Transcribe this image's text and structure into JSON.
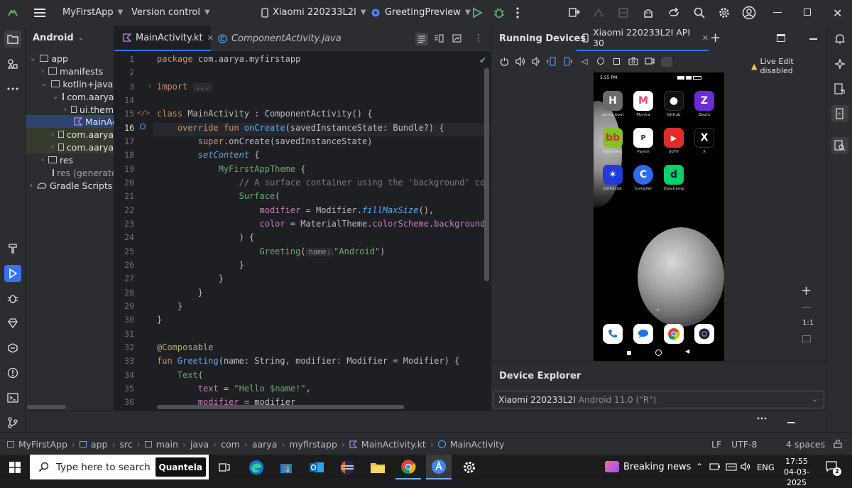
{
  "titlebar": {
    "project_name": "MyFirstApp",
    "vcs_label": "Version control",
    "device_name": "Xiaomi 220233L2I",
    "run_config": "GreetingPreview"
  },
  "project_panel": {
    "view_label": "Android",
    "tree": [
      {
        "label": "app"
      },
      {
        "label": "manifests"
      },
      {
        "label": "kotlin+java"
      },
      {
        "label": "com.aarya"
      },
      {
        "label": "ui.them"
      },
      {
        "label": "MainAc"
      },
      {
        "label": "com.aarya"
      },
      {
        "label": "com.aarya"
      },
      {
        "label": "res"
      },
      {
        "label": "res (generate"
      },
      {
        "label": "Gradle Scripts"
      }
    ]
  },
  "editor": {
    "tabs": [
      {
        "label": "MainActivity.kt"
      },
      {
        "label": "ComponentActivity.java"
      }
    ],
    "line_numbers": [
      "1",
      "2",
      "3",
      "14",
      "15",
      "16",
      "17",
      "18",
      "19",
      "20",
      "21",
      "22",
      "23",
      "24",
      "25",
      "26",
      "27",
      "28",
      "29",
      "30",
      "31",
      "32",
      "33",
      "34",
      "35",
      "36"
    ],
    "code": {
      "l1_kw": "package",
      "l1_rest": " com.aarya.myfirstapp",
      "l3_kw": "import",
      "l3_fold": "...",
      "l15_a": "class",
      "l15_b": " MainActivity : ComponentActivity() {",
      "l16_indent": "    ",
      "l16_kw": "override fun",
      "l16_fn": " onCreate",
      "l16_rest": "(savedInstanceState: Bundle?) {",
      "l17_indent": "        ",
      "l17_kw": "super",
      "l17_rest": ".onCreate(savedInstanceState)",
      "l18_indent": "        ",
      "l18_fn": "setContent",
      "l18_rest": " {",
      "l19_indent": "            ",
      "l19_comp": "MyFirstAppTheme",
      "l19_rest": " {",
      "l20_indent": "                ",
      "l20_cm": "// A surface container using the 'background' color",
      "l21_indent": "                ",
      "l21_comp": "Surface",
      "l21_rest": "(",
      "l22_indent": "                    ",
      "l22_prop": "modifier",
      "l22_mid": " = Modifier.",
      "l22_fn": "fillMaxSize",
      "l22_rest": "(),",
      "l23_indent": "                    ",
      "l23_prop": "color",
      "l23_mid": " = MaterialTheme.",
      "l23_p2": "colorScheme",
      "l23_dot": ".",
      "l23_p3": "background",
      "l24_indent": "                ",
      "l24_rest": ") {",
      "l25_indent": "                    ",
      "l25_comp": "Greeting",
      "l25_paren": "(",
      "l25_hint": "name:",
      "l25_str": "\"Android\"",
      "l25_close": ")",
      "l26_indent": "                ",
      "l26_rest": "}",
      "l27_indent": "            ",
      "l27_rest": "}",
      "l28_indent": "        ",
      "l28_rest": "}",
      "l29_indent": "    ",
      "l29_rest": "}",
      "l30": "}",
      "l32_ann": "@Composable",
      "l33_kw": "fun",
      "l33_fn": " Greeting",
      "l33_rest": "(name: String, modifier: Modifier = Modifier) {",
      "l34_indent": "    ",
      "l34_comp": "Text",
      "l34_rest": "(",
      "l35_indent": "        ",
      "l35_prop": "text",
      "l35_mid": " = ",
      "l35_str": "\"Hello $name!\"",
      "l35_rest": ",",
      "l36_indent": "        ",
      "l36_prop": "modifier",
      "l36_rest": " = modifier"
    }
  },
  "running_devices": {
    "title": "Running Devices",
    "device_tab": "Xiaomi 220233L2I API 30",
    "live_edit": "Live Edit disabled",
    "zoom_label": "1:1",
    "phone": {
      "status_time": "5:55 PM",
      "apps": [
        {
          "label": "spring boot",
          "glyph": "H",
          "color": "#6b6b6b"
        },
        {
          "label": "Myntra",
          "glyph": "M",
          "color": "#e8477b"
        },
        {
          "label": "GitHub",
          "glyph": "●",
          "color": "#111111"
        },
        {
          "label": "Zepto",
          "glyph": "Z",
          "color": "#6b2bd9"
        },
        {
          "label": "bigbasket",
          "glyph": "bb",
          "color": "#84c225"
        },
        {
          "label": "Paytm",
          "glyph": "P",
          "color": "#ffffff"
        },
        {
          "label": "JioTV",
          "glyph": "▶",
          "color": "#e22b2b"
        },
        {
          "label": "X",
          "glyph": "X",
          "color": "#000000"
        },
        {
          "label": "JioHotstar",
          "glyph": "✶",
          "color": "#1f3bdb"
        },
        {
          "label": "Compiler",
          "glyph": "C",
          "color": "#2d6cf2"
        },
        {
          "label": "DataCamp",
          "glyph": "d",
          "color": "#05d26a"
        }
      ]
    }
  },
  "device_explorer": {
    "title": "Device Explorer",
    "device": "Xiaomi 220233L2I",
    "android": "Android 11.0 (\"R\")"
  },
  "statusbar": {
    "breadcrumbs": [
      "MyFirstApp",
      "app",
      "src",
      "main",
      "java",
      "com",
      "aarya",
      "myfirstapp",
      "MainActivity.kt",
      "MainActivity"
    ],
    "line_sep": "LF",
    "encoding": "UTF-8",
    "indent": "4 spaces"
  },
  "taskbar": {
    "search_placeholder": "Type here to search",
    "search_brand": "Quantela",
    "news": "Breaking news",
    "lang": "ENG",
    "time": "17:55",
    "date": "04-03-2025",
    "notif_count": "2"
  },
  "colors": {
    "ide_bg": "#1e1f22",
    "panel_bg": "#2b2d30",
    "accent": "#3574f0",
    "run_green": "#5fb865"
  }
}
